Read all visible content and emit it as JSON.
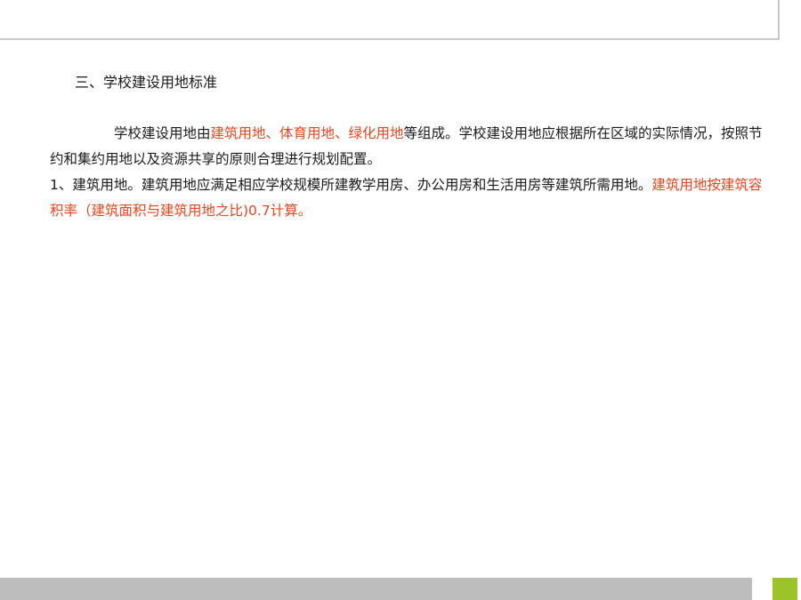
{
  "slide": {
    "heading": "三、学校建设用地标准",
    "paragraph1": {
      "prefix": "学校建设用地由",
      "highlight": "建筑用地、体育用地、绿化用地",
      "suffix": "等组成。学校建设用地应根据所在区域的实际情况，按照节约和集约用地以及资源共享的原则合理进行规划配置。"
    },
    "paragraph2": {
      "prefix": "1、建筑用地。建筑用地应满足相应学校规模所建教学用房、办公用房和生活用房等建筑所需用地。",
      "highlight": "建筑用地按建筑容积率（建筑面积与建筑用地之比)0.7计算。"
    }
  },
  "colors": {
    "highlight": "#e8461e",
    "accent_square": "#9dc32b",
    "bottom_bar": "#bdbdbd",
    "rule": "#c8c8c8"
  }
}
